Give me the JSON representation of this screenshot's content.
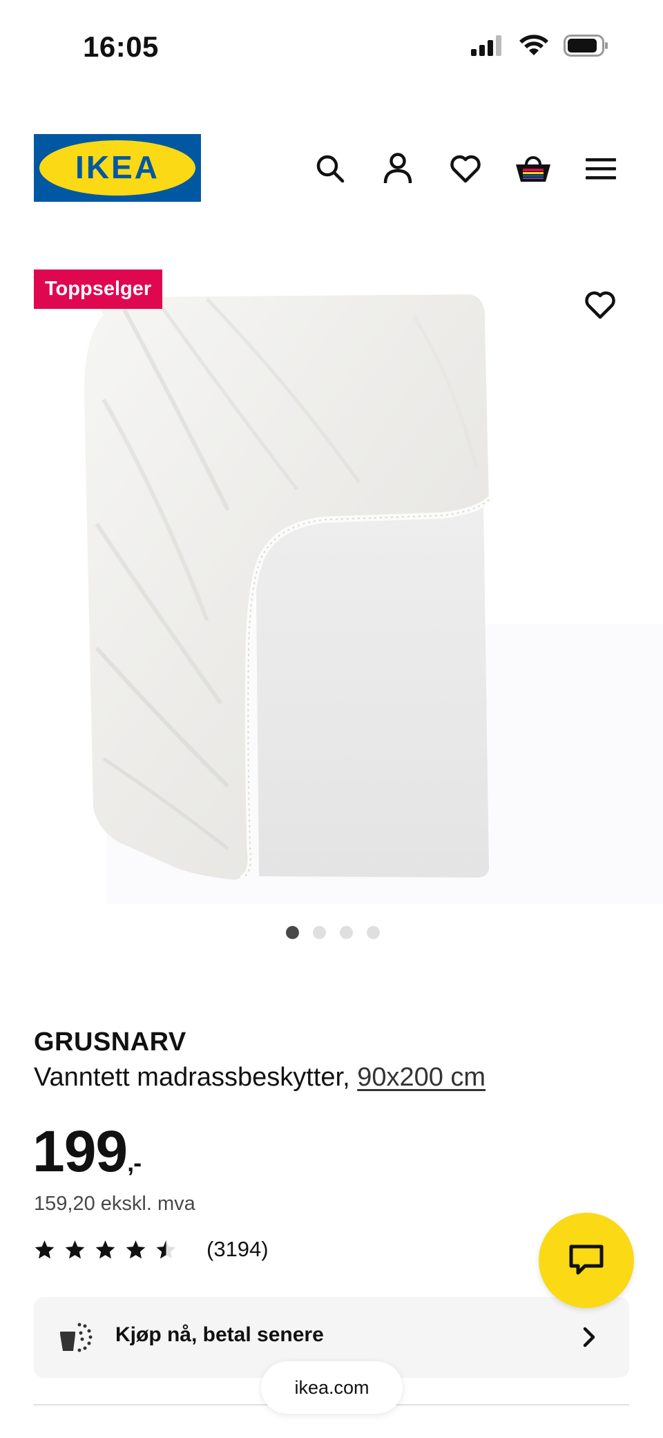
{
  "status_bar": {
    "time": "16:05",
    "signal_icon": "cellular-signal-icon",
    "wifi_icon": "wifi-icon",
    "battery_icon": "battery-icon"
  },
  "header": {
    "logo_text": "IKEA",
    "icons": [
      "search-icon",
      "account-icon",
      "heart-icon",
      "shopping-bag-icon",
      "menu-icon"
    ]
  },
  "product": {
    "badge": "Toppselger",
    "image_count": 4,
    "active_image": 1,
    "name": "GRUSNARV",
    "description": "Vanntett madrassbeskytter,",
    "size": "90x200 cm",
    "price": "199",
    "price_suffix": ",-",
    "price_ex_vat": "159,20 ekskl. mva",
    "rating": 4.5,
    "rating_count": "(3194)"
  },
  "bnpl": {
    "label": "Kjøp nå, betal senere"
  },
  "browser": {
    "url": "ikea.com"
  },
  "colors": {
    "brand_blue": "#0058a3",
    "brand_yellow": "#fbd914",
    "badge_red": "#e00751"
  }
}
